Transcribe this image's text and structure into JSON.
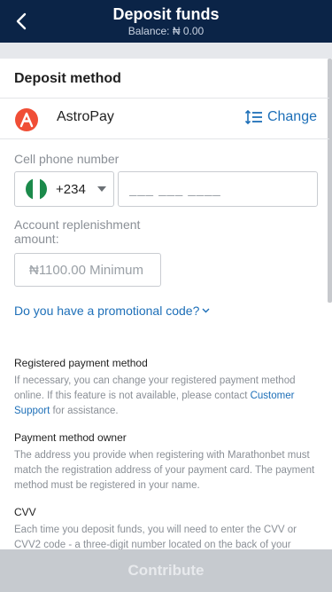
{
  "header": {
    "title": "Deposit funds",
    "balance": "Balance: ₦ 0.00"
  },
  "deposit_method": {
    "title": "Deposit method",
    "method_name": "AstroPay",
    "logo_letter": "A",
    "change_label": "Change"
  },
  "phone": {
    "label": "Cell phone number",
    "country_code": "+234",
    "placeholder": "___ ___ ____"
  },
  "amount": {
    "label_line1": "Account replenishment",
    "label_line2": "amount:",
    "placeholder": "₦1100.00 Minimum"
  },
  "promo": {
    "link_text": "Do you have a promotional code?"
  },
  "info": {
    "registered_title": "Registered payment method",
    "registered_text_before": "If necessary, you can change your registered payment method online. If this feature is not available, please contact ",
    "registered_link": "Customer Support",
    "registered_text_after": " for assistance.",
    "owner_title": "Payment method owner",
    "owner_text": "The address you provide when registering with Marathonbet must match the registration address of your payment card. The payment method must be registered in your name.",
    "cvv_title": "CVV",
    "cvv_text": "Each time you deposit funds, you will need to enter the CVV or CVV2 code - a three-digit number located on the back of your"
  },
  "footer": {
    "button_label": "Contribute"
  },
  "colors": {
    "header_bg": "#0b2447",
    "accent_link": "#1d6fb8",
    "logo_red": "#f04e36",
    "flag_green": "#1b8a4b",
    "footer_disabled": "#c6cacf"
  }
}
